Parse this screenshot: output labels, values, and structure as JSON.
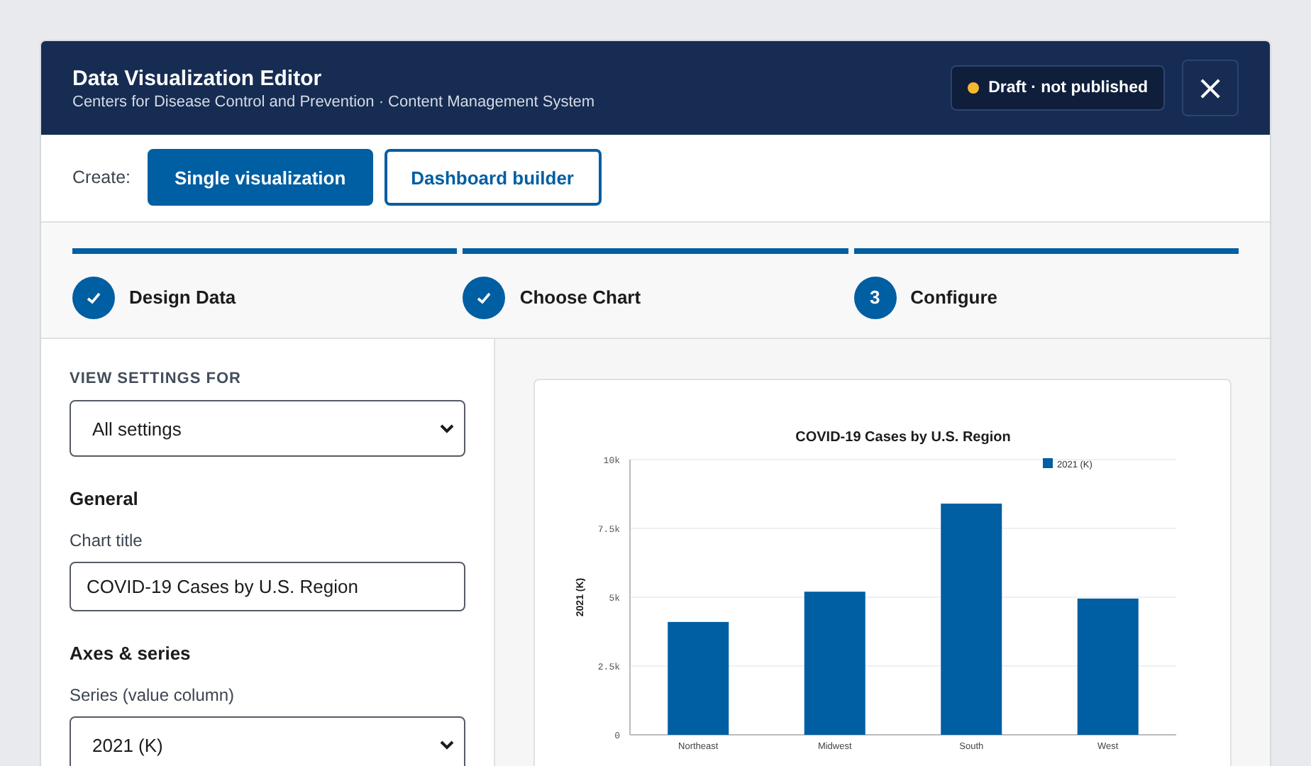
{
  "header": {
    "title": "Data Visualization Editor",
    "subtitle": "Centers for Disease Control and Prevention · Content Management System",
    "status": {
      "label": "Draft · not published",
      "color": "#f5b82e"
    },
    "close": "×"
  },
  "create": {
    "label": "Create:",
    "options": [
      {
        "label": "Single visualization",
        "selected": true
      },
      {
        "label": "Dashboard builder",
        "selected": false
      }
    ]
  },
  "steps": [
    {
      "label": "Design Data",
      "completed": true
    },
    {
      "label": "Choose Chart",
      "completed": true
    },
    {
      "label": "Configure",
      "completed": false,
      "number": "3"
    }
  ],
  "settings": {
    "heading": "VIEW SETTINGS FOR",
    "view": "All settings",
    "sections": [
      {
        "title": "General",
        "field_label": "Chart title",
        "kind": "text",
        "value": "COVID-19 Cases by U.S. Region"
      },
      {
        "title": "Axes & series",
        "field_label": "Series (value column)",
        "kind": "select",
        "value": "2021 (K)"
      }
    ]
  },
  "preview": {
    "chart_data": {
      "type": "bar",
      "title": "COVID-19 Cases by U.S. Region",
      "ylabel": "2021 (K)",
      "categories": [
        "Northeast",
        "Midwest",
        "South",
        "West"
      ],
      "series": [
        {
          "name": "2021 (K)",
          "color": "#005ea2",
          "values": [
            4100,
            5200,
            8400,
            4950
          ]
        }
      ],
      "ylim": [
        0,
        10000
      ],
      "grid": true,
      "yticks": [
        {
          "value": 0,
          "label": "0"
        },
        {
          "value": 2500,
          "label": "2.5k"
        },
        {
          "value": 5000,
          "label": "5k"
        },
        {
          "value": 7500,
          "label": "7.5k"
        },
        {
          "value": 10000,
          "label": "10k"
        }
      ]
    }
  }
}
